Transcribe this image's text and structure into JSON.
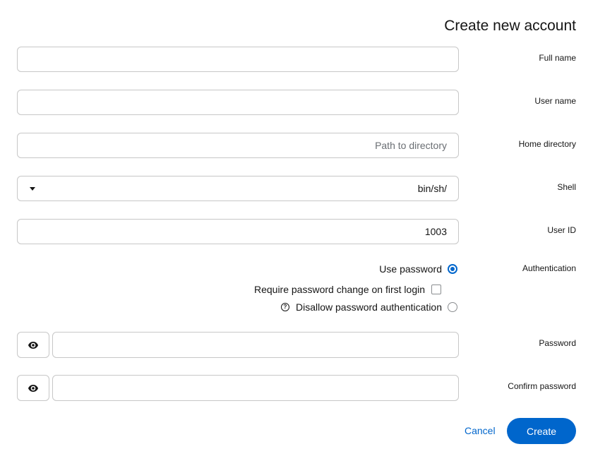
{
  "dialog": {
    "title": "Create new account"
  },
  "fields": {
    "full_name": {
      "label": "Full name",
      "value": "",
      "placeholder": ""
    },
    "user_name": {
      "label": "User name",
      "value": "",
      "placeholder": ""
    },
    "home_directory": {
      "label": "Home directory",
      "value": "",
      "placeholder": "Path to directory"
    },
    "shell": {
      "label": "Shell",
      "selected": "bin/sh/"
    },
    "user_id": {
      "label": "User ID",
      "value": "1003"
    }
  },
  "authentication": {
    "label": "Authentication",
    "use_password": "Use password",
    "require_change": "Require password change on first login",
    "disallow_password": "Disallow password authentication",
    "selected_option": "use_password"
  },
  "password": {
    "label": "Password",
    "value": ""
  },
  "confirm_password": {
    "label": "Confirm password",
    "value": ""
  },
  "buttons": {
    "cancel": "Cancel",
    "create": "Create"
  },
  "colors": {
    "accent": "#0066cc",
    "border": "#c7c7c7",
    "placeholder": "#6a6e73"
  },
  "icons": {
    "show_password": "eye-icon",
    "help": "help-circle-icon",
    "dropdown": "caret-down-icon"
  }
}
